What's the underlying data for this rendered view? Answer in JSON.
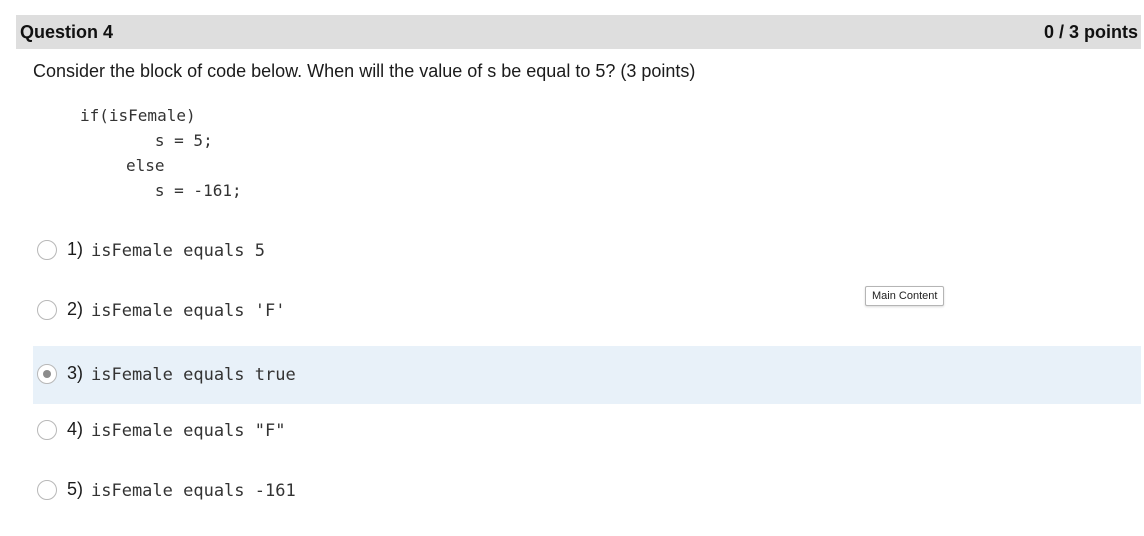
{
  "question": {
    "title": "Question 4",
    "points": "0 / 3 points",
    "prompt": "Consider the block of code below. When will the value of s be equal to 5? (3 points)",
    "code_lines": [
      "if(isFemale)",
      "   s = 5;",
      "else",
      "   s = -161;"
    ]
  },
  "options": [
    {
      "number": "1)",
      "code": "isFemale equals 5",
      "selected": false
    },
    {
      "number": "2)",
      "code": "isFemale equals 'F'",
      "selected": false
    },
    {
      "number": "3)",
      "code": "isFemale equals true",
      "selected": true
    },
    {
      "number": "4)",
      "code": "isFemale equals \"F\"",
      "selected": false
    },
    {
      "number": "5)",
      "code": "isFemale equals -161",
      "selected": false
    }
  ],
  "tooltip": {
    "text": "Main Content"
  },
  "colors": {
    "header_bg": "#dedede",
    "selected_row_bg": "#e8f1f9"
  }
}
